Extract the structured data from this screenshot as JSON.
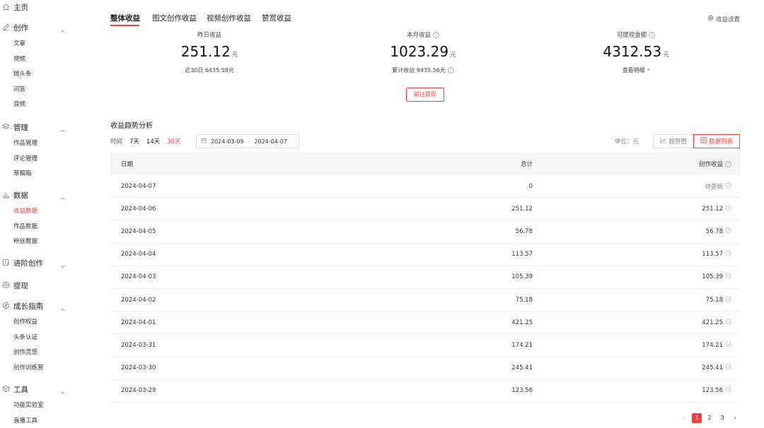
{
  "sidebar": {
    "home": "主页",
    "groups": [
      {
        "label": "创作",
        "icon": "pen-icon",
        "items": [
          "文章",
          "视频",
          "微头条",
          "问答",
          "音频"
        ]
      },
      {
        "label": "管理",
        "icon": "layers-icon",
        "items": [
          "作品管理",
          "评论管理",
          "草稿箱"
        ]
      },
      {
        "label": "数据",
        "icon": "chart-icon",
        "items": [
          "收益数据",
          "作品数据",
          "粉丝数据"
        ]
      },
      {
        "label": "进阶创作",
        "icon": "edit-icon",
        "items": []
      },
      {
        "label": "提现",
        "icon": "coin-icon",
        "items": []
      },
      {
        "label": "成长指南",
        "icon": "compass-icon",
        "items": [
          "创作权益",
          "头条认证",
          "创作灵感",
          "创作训练营"
        ]
      },
      {
        "label": "工具",
        "icon": "cube-icon",
        "items": [
          "功能实验室",
          "直播工具"
        ]
      }
    ],
    "active_item": "收益数据",
    "active_color": "#f04142"
  },
  "tabs": [
    "整体收益",
    "图文创作收益",
    "视频创作收益",
    "赞赏收益"
  ],
  "settings_label": "收益设置",
  "stats": {
    "yesterday": {
      "label": "昨日收益",
      "value": "251.12",
      "unit": "元",
      "sub": "近30日 6435.58元"
    },
    "month": {
      "label": "本月收益",
      "value": "1023.29",
      "unit": "元",
      "sub": "累计收益 9435.56元"
    },
    "withdrawable": {
      "label": "可提现金额",
      "value": "4312.53",
      "unit": "元",
      "sub": "查看明细"
    }
  },
  "withdraw_button": "前往提现",
  "trend": {
    "title": "收益趋势分析",
    "time_label": "时间",
    "ranges": [
      "7天",
      "14天",
      "30天"
    ],
    "active_range": "30天",
    "date_start": "2024-03-09",
    "date_sep": "-",
    "date_end": "2024-04-07",
    "unit_label": "单位：元",
    "view_chart": "趋势图",
    "view_table": "数据列表"
  },
  "table": {
    "headers": {
      "date": "日期",
      "total": "总计",
      "create": "创作收益"
    },
    "rows": [
      {
        "date": "2024-04-07",
        "total": "0",
        "create": "待更新"
      },
      {
        "date": "2024-04-06",
        "total": "251.12",
        "create": "251.12"
      },
      {
        "date": "2024-04-05",
        "total": "56.78",
        "create": "56.78"
      },
      {
        "date": "2024-04-04",
        "total": "113.57",
        "create": "113.57"
      },
      {
        "date": "2024-04-03",
        "total": "105.39",
        "create": "105.39"
      },
      {
        "date": "2024-04-02",
        "total": "75.18",
        "create": "75.18"
      },
      {
        "date": "2024-04-01",
        "total": "421.25",
        "create": "421.25"
      },
      {
        "date": "2024-03-31",
        "total": "174.21",
        "create": "174.21"
      },
      {
        "date": "2024-03-30",
        "total": "245.41",
        "create": "245.41"
      },
      {
        "date": "2024-03-29",
        "total": "123.56",
        "create": "123.56"
      }
    ]
  },
  "pagination": {
    "pages": [
      "1",
      "2",
      "3"
    ],
    "current": "1",
    "prev": "‹",
    "next": "›"
  }
}
